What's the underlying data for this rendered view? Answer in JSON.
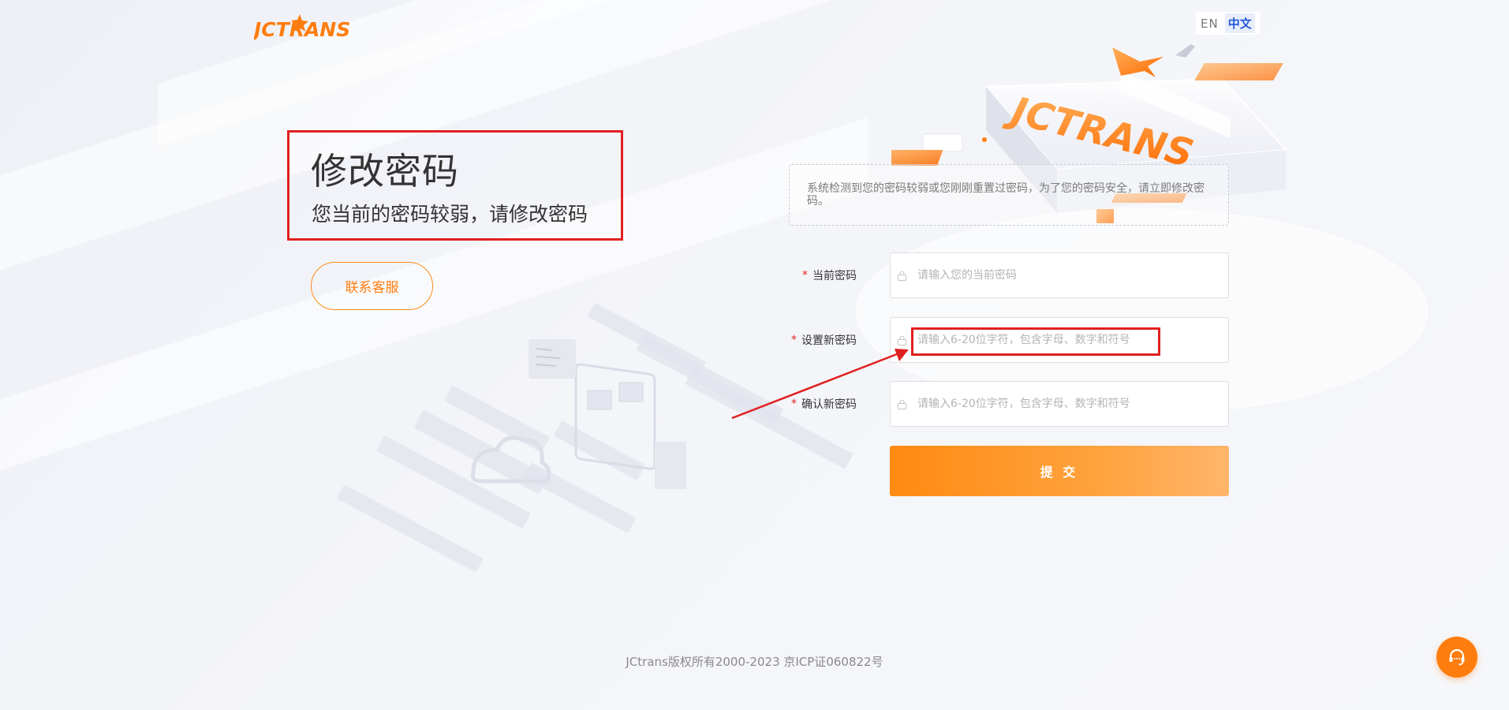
{
  "brand": {
    "logo_text": "JCTRANS"
  },
  "language": {
    "en_label": "EN",
    "zh_label": "中文"
  },
  "page": {
    "title": "修改密码",
    "subtitle": "您当前的密码较弱，请修改密码",
    "contact_button": "联系客服"
  },
  "notice": {
    "text": "系统检测到您的密码较弱或您刚刚重置过密码，为了您的密码安全，请立即修改密码。"
  },
  "form": {
    "current_password": {
      "label": "当前密码",
      "placeholder": "请输入您的当前密码"
    },
    "new_password": {
      "label": "设置新密码",
      "placeholder": "请输入6-20位字符，包含字母、数字和符号"
    },
    "confirm_password": {
      "label": "确认新密码",
      "placeholder": "请输入6-20位字符，包含字母、数字和符号"
    },
    "required_mark": "*",
    "submit_label": "提 交"
  },
  "footer": {
    "copyright": "JCtrans版权所有2000-2023 京ICP证060822号"
  },
  "colors": {
    "accent": "#ff7d0e",
    "highlight": "#e02020",
    "link": "#2457d9"
  },
  "icons": {
    "lock": "lock-icon",
    "service": "headset-icon"
  }
}
